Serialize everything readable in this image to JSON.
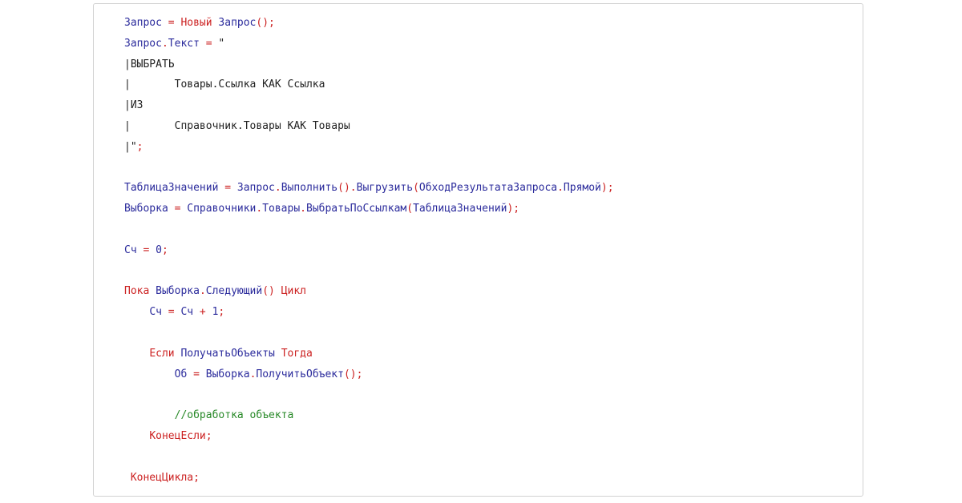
{
  "code_lines": [
    [
      {
        "t": "Запрос",
        "c": "id"
      },
      {
        "t": " = ",
        "c": "op"
      },
      {
        "t": "Новый",
        "c": "kw"
      },
      {
        "t": " Запрос",
        "c": "id"
      },
      {
        "t": "();",
        "c": "op"
      }
    ],
    [
      {
        "t": "Запрос",
        "c": "id"
      },
      {
        "t": ".",
        "c": "op"
      },
      {
        "t": "Текст",
        "c": "id"
      },
      {
        "t": " = ",
        "c": "op"
      },
      {
        "t": "\"",
        "c": "str"
      }
    ],
    [
      {
        "t": "|ВЫБРАТЬ",
        "c": "str"
      }
    ],
    [
      {
        "t": "|       Товары.Ссылка КАК Ссылка",
        "c": "str"
      }
    ],
    [
      {
        "t": "|ИЗ",
        "c": "str"
      }
    ],
    [
      {
        "t": "|       Справочник.Товары КАК Товары",
        "c": "str"
      }
    ],
    [
      {
        "t": "|\"",
        "c": "str"
      },
      {
        "t": ";",
        "c": "op"
      }
    ],
    [],
    [
      {
        "t": "ТаблицаЗначений",
        "c": "id"
      },
      {
        "t": " = ",
        "c": "op"
      },
      {
        "t": "Запрос",
        "c": "id"
      },
      {
        "t": ".",
        "c": "op"
      },
      {
        "t": "Выполнить",
        "c": "id"
      },
      {
        "t": "().",
        "c": "op"
      },
      {
        "t": "Выгрузить",
        "c": "id"
      },
      {
        "t": "(",
        "c": "op"
      },
      {
        "t": "ОбходРезультатаЗапроса",
        "c": "id"
      },
      {
        "t": ".",
        "c": "op"
      },
      {
        "t": "Прямой",
        "c": "id"
      },
      {
        "t": ");",
        "c": "op"
      }
    ],
    [
      {
        "t": "Выборка",
        "c": "id"
      },
      {
        "t": " = ",
        "c": "op"
      },
      {
        "t": "Справочники",
        "c": "id"
      },
      {
        "t": ".",
        "c": "op"
      },
      {
        "t": "Товары",
        "c": "id"
      },
      {
        "t": ".",
        "c": "op"
      },
      {
        "t": "ВыбратьПоСсылкам",
        "c": "id"
      },
      {
        "t": "(",
        "c": "op"
      },
      {
        "t": "ТаблицаЗначений",
        "c": "id"
      },
      {
        "t": ");",
        "c": "op"
      }
    ],
    [],
    [
      {
        "t": "Сч",
        "c": "id"
      },
      {
        "t": " = ",
        "c": "op"
      },
      {
        "t": "0",
        "c": "num"
      },
      {
        "t": ";",
        "c": "op"
      }
    ],
    [],
    [
      {
        "t": "Пока",
        "c": "kw"
      },
      {
        "t": " Выборка",
        "c": "id"
      },
      {
        "t": ".",
        "c": "op"
      },
      {
        "t": "Следующий",
        "c": "id"
      },
      {
        "t": "() ",
        "c": "op"
      },
      {
        "t": "Цикл",
        "c": "kw"
      }
    ],
    [
      {
        "t": "    ",
        "c": "id"
      },
      {
        "t": "Сч",
        "c": "id"
      },
      {
        "t": " = ",
        "c": "op"
      },
      {
        "t": "Сч",
        "c": "id"
      },
      {
        "t": " + ",
        "c": "op"
      },
      {
        "t": "1",
        "c": "num"
      },
      {
        "t": ";",
        "c": "op"
      }
    ],
    [],
    [
      {
        "t": "    ",
        "c": "id"
      },
      {
        "t": "Если",
        "c": "kw"
      },
      {
        "t": " ПолучатьОбъекты ",
        "c": "id"
      },
      {
        "t": "Тогда",
        "c": "kw"
      }
    ],
    [
      {
        "t": "        ",
        "c": "id"
      },
      {
        "t": "Об",
        "c": "id"
      },
      {
        "t": " = ",
        "c": "op"
      },
      {
        "t": "Выборка",
        "c": "id"
      },
      {
        "t": ".",
        "c": "op"
      },
      {
        "t": "ПолучитьОбъект",
        "c": "id"
      },
      {
        "t": "();",
        "c": "op"
      }
    ],
    [],
    [
      {
        "t": "        ",
        "c": "id"
      },
      {
        "t": "//обработка объекта",
        "c": "cm"
      }
    ],
    [
      {
        "t": "    ",
        "c": "id"
      },
      {
        "t": "КонецЕсли;",
        "c": "kw"
      }
    ],
    [],
    [
      {
        "t": " ",
        "c": "id"
      },
      {
        "t": "КонецЦикла;",
        "c": "kw"
      }
    ]
  ]
}
